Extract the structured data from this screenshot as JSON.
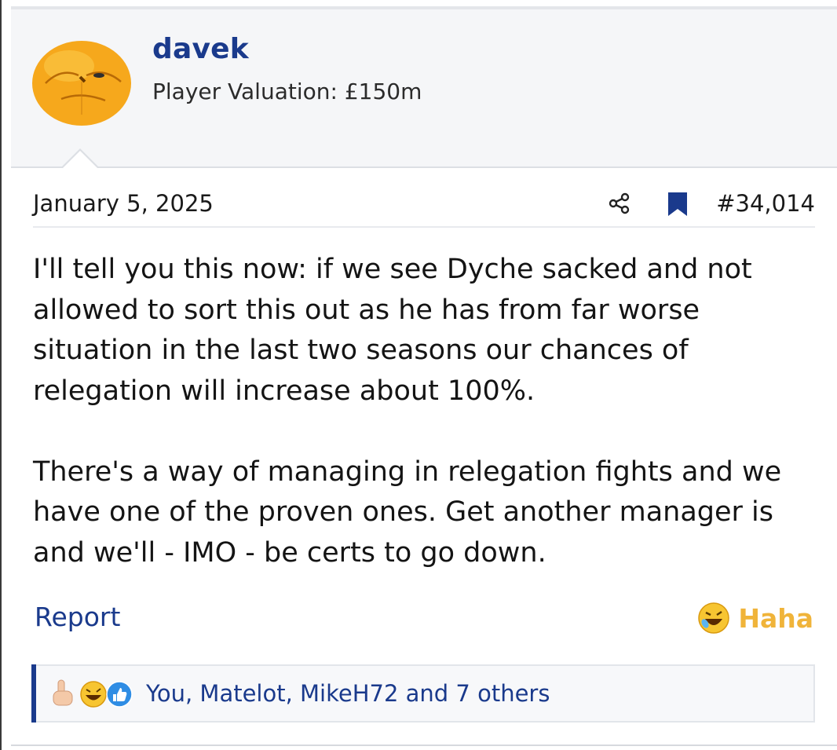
{
  "user": {
    "name": "davek",
    "title": "Player Valuation: £150m",
    "avatar": "orange-face-avatar"
  },
  "post": {
    "date": "January 5, 2025",
    "number": "#34,014",
    "icons": {
      "share": "share-icon",
      "bookmark": "bookmark-icon"
    },
    "paragraphs": [
      "I'll tell you this now: if we see Dyche sacked and not allowed to sort this out as he has from far worse situation in the last two seasons our chances of relegation will increase about 100%.",
      "There's a way of managing in relegation fights and we have one of the proven ones. Get another manager is and we'll - IMO - be certs to go down."
    ]
  },
  "actions": {
    "report_label": "Report",
    "reaction_label": "Haha"
  },
  "reactions": {
    "summary": "You, Matelot, MikeH72 and 7 others",
    "icons": [
      "middle-finger-icon",
      "rofl-icon",
      "like-icon"
    ]
  },
  "colors": {
    "link": "#1a3a8c",
    "haha": "#f0b43a",
    "header_bg": "#f5f6f8"
  }
}
